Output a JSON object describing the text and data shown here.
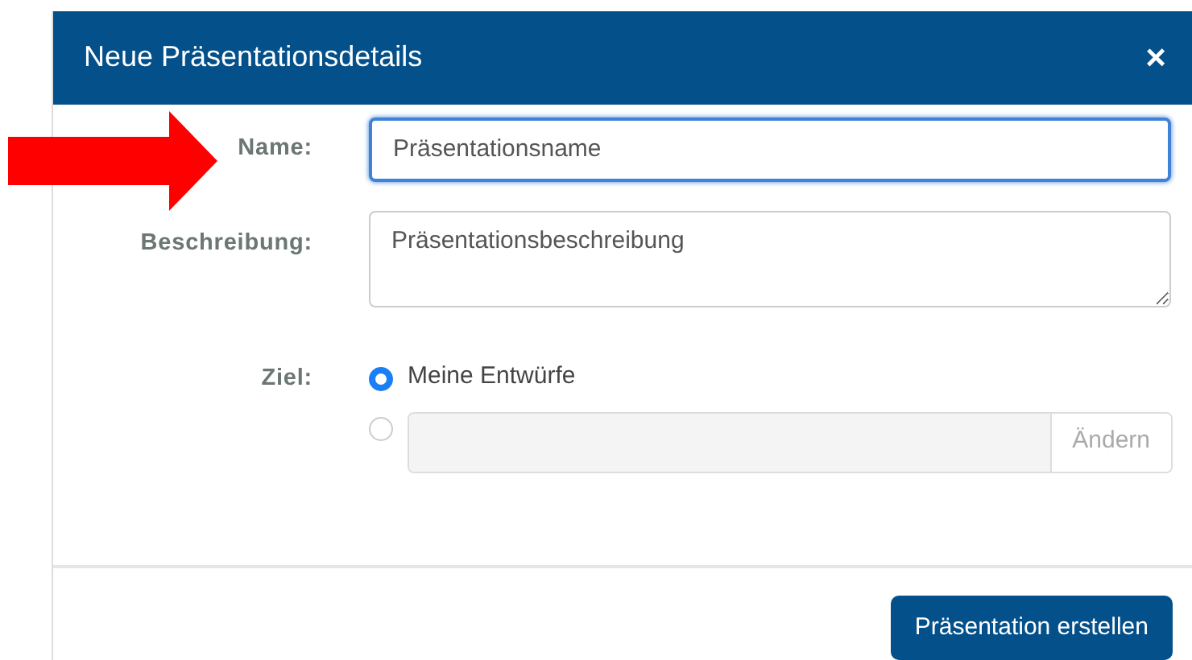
{
  "dialog": {
    "title": "Neue Präsentationsdetails",
    "close": "×"
  },
  "fields": [
    {
      "label": "Name:",
      "kind": "input",
      "placeholder": "Präsentationsname",
      "focused": true
    },
    {
      "label": "Beschreibung:",
      "kind": "textarea",
      "placeholder": "Präsentationsbeschreibung",
      "focused": false
    }
  ],
  "target": {
    "label": "Ziel:",
    "options": [
      {
        "kind": "text",
        "text": "Meine Entwürfe",
        "selected": true
      },
      {
        "kind": "path",
        "button": "Ändern",
        "selected": false
      }
    ]
  },
  "buttons": [
    "Präsentation erstellen"
  ]
}
